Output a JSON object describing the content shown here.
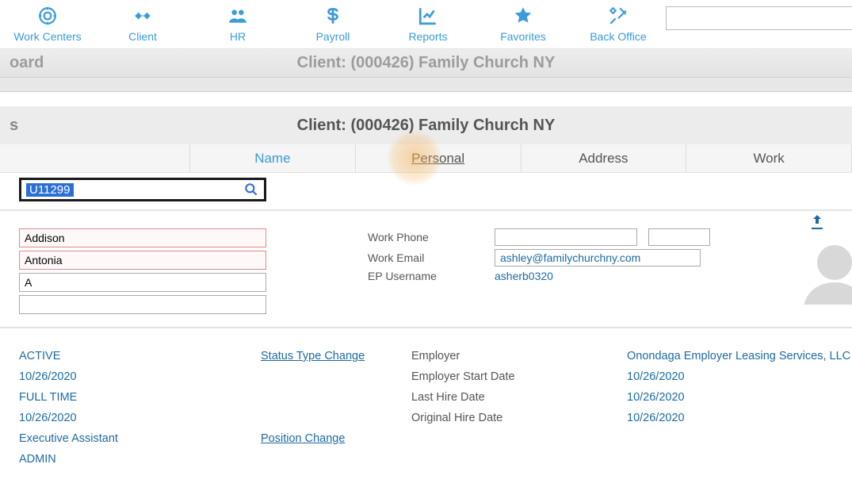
{
  "nav": {
    "items": [
      {
        "label": "Work Centers",
        "icon": "target-icon"
      },
      {
        "label": "Client",
        "icon": "handshake-icon"
      },
      {
        "label": "HR",
        "icon": "people-icon"
      },
      {
        "label": "Payroll",
        "icon": "dollar-icon"
      },
      {
        "label": "Reports",
        "icon": "chart-icon"
      },
      {
        "label": "Favorites",
        "icon": "star-icon"
      },
      {
        "label": "Back Office",
        "icon": "tools-icon"
      }
    ]
  },
  "breadcrumb": {
    "top_left": "oard",
    "top_center": "Client: (000426) Family Church NY",
    "sub_left": "s",
    "sub_center": "Client: (000426) Family Church NY"
  },
  "tabs": [
    {
      "label": "Name",
      "active": true,
      "highlighted": false
    },
    {
      "label": "Personal",
      "active": false,
      "highlighted": true
    },
    {
      "label": "Address",
      "active": false,
      "highlighted": false
    },
    {
      "label": "Work",
      "active": false,
      "highlighted": false
    }
  ],
  "id_search": {
    "value": "U11299"
  },
  "names": {
    "first": "Addison",
    "last": "Antonia",
    "mi": "A",
    "suffix": ""
  },
  "contact": {
    "work_phone_label": "Work Phone",
    "work_phone": "",
    "work_phone_ext": "",
    "work_email_label": "Work Email",
    "work_email": "ashley@familychurchny.com",
    "ep_username_label": "EP Username",
    "ep_username": "asherb0320"
  },
  "emp_left": {
    "status": "ACTIVE",
    "status_date": "10/26/2020",
    "type": "FULL TIME",
    "type_date": "10/26/2020",
    "position": "Executive Assistant",
    "dept": "ADMIN"
  },
  "emp_left_links": {
    "status_type_change": "Status Type Change",
    "position_change": "Position Change"
  },
  "emp_right_labels": {
    "employer": "Employer",
    "employer_start_date": "Employer Start Date",
    "last_hire_date": "Last Hire Date",
    "original_hire_date": "Original Hire Date"
  },
  "emp_right_values": {
    "employer": "Onondaga Employer Leasing Services, LLC",
    "employer_start_date": "10/26/2020",
    "last_hire_date": "10/26/2020",
    "original_hire_date": "10/26/2020"
  },
  "colors": {
    "accent": "#3a9bd9",
    "link": "#1d6aa3",
    "error_border": "#e08a8a"
  }
}
